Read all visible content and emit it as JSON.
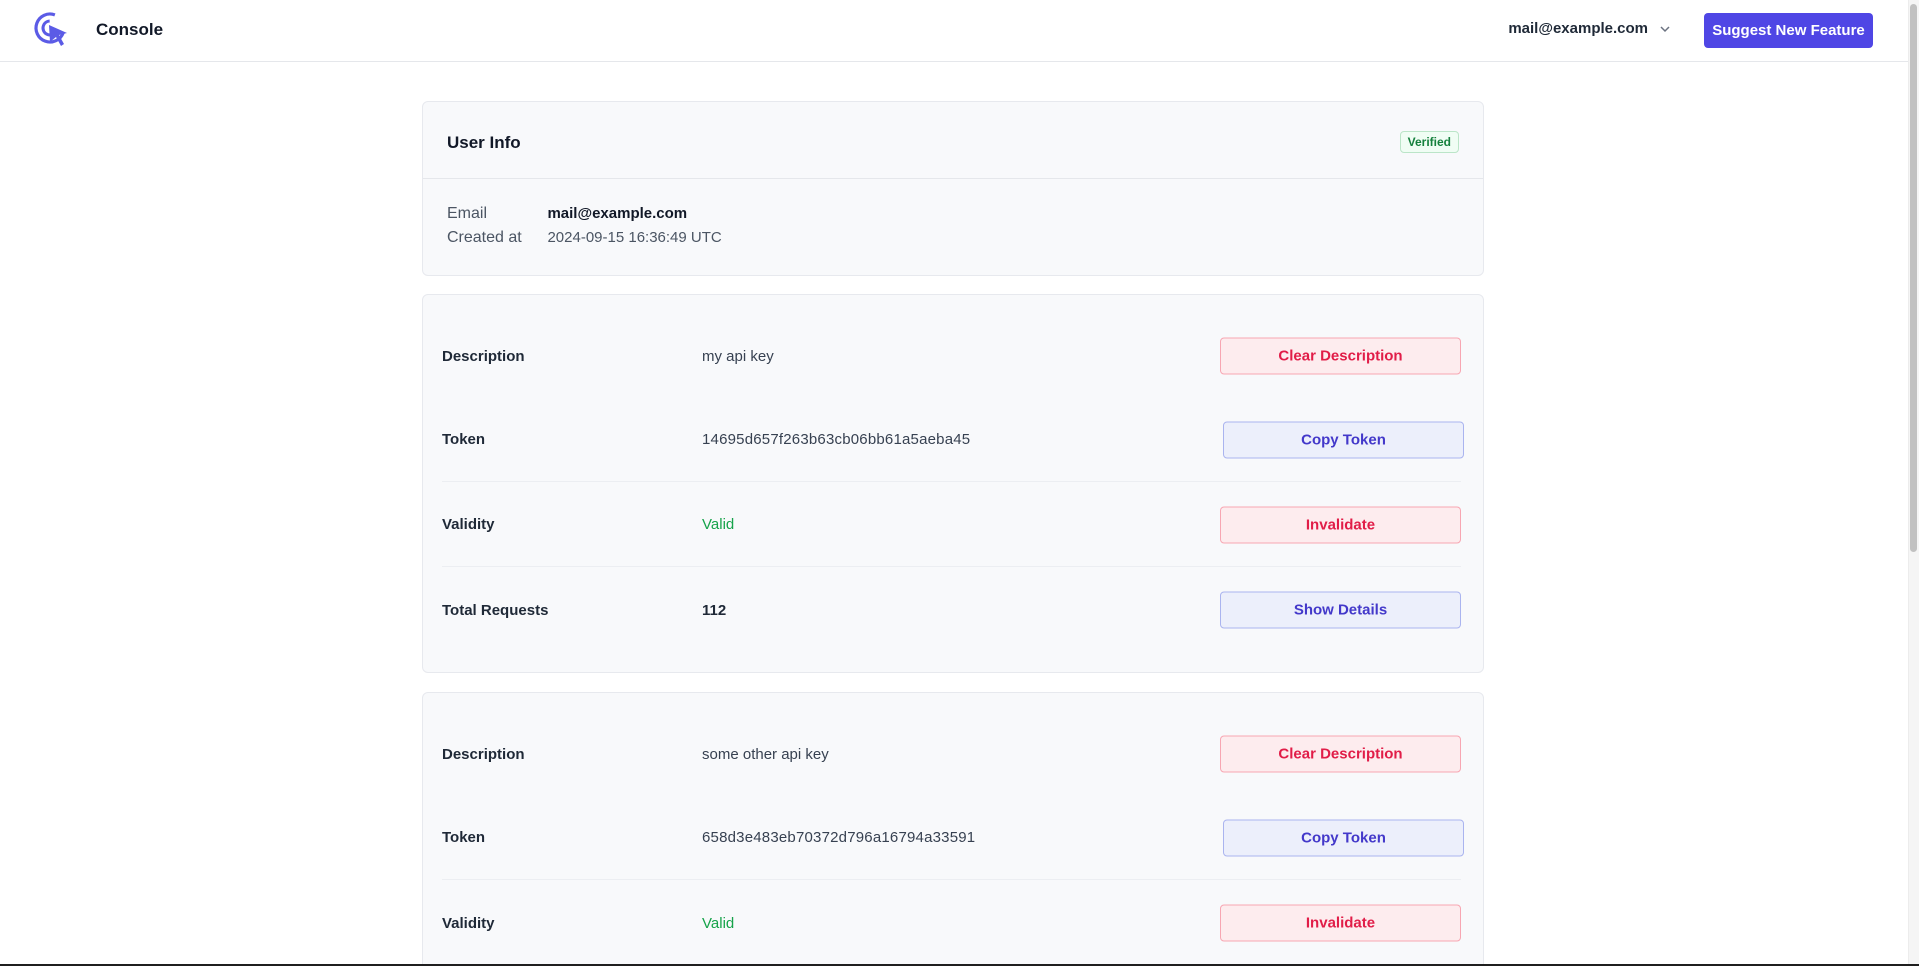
{
  "header": {
    "app_title": "Console",
    "account_email": "mail@example.com",
    "suggest_label": "Suggest New Feature",
    "brand_color": "#4f46e5"
  },
  "user_info": {
    "title": "User Info",
    "badge": "Verified",
    "email_label": "Email",
    "email_value": "mail@example.com",
    "created_label": "Created at",
    "created_value": "2024-09-15 16:36:49 UTC"
  },
  "keys": [
    {
      "description_label": "Description",
      "description_value": "my api key",
      "clear_label": "Clear Description",
      "token_label": "Token",
      "token_value": "14695d657f263b63cb06bb61a5aeba45",
      "copy_label": "Copy Token",
      "validity_label": "Validity",
      "validity_value": "Valid",
      "invalidate_label": "Invalidate",
      "requests_label": "Total Requests",
      "requests_value": "112",
      "details_label": "Show Details"
    },
    {
      "description_label": "Description",
      "description_value": "some other api key",
      "clear_label": "Clear Description",
      "token_label": "Token",
      "token_value": "658d3e483eb70372d796a16794a33591",
      "copy_label": "Copy Token",
      "validity_label": "Validity",
      "validity_value": "Valid",
      "invalidate_label": "Invalidate"
    }
  ]
}
